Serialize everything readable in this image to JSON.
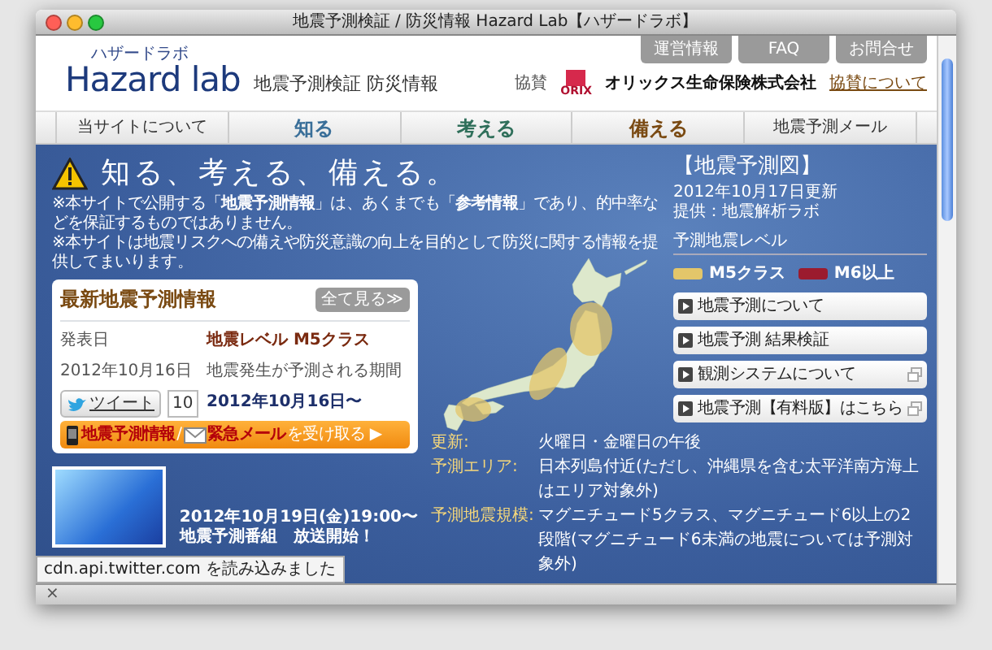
{
  "window": {
    "title": "地震予測検証 / 防災情報 Hazard Lab【ハザードラボ】"
  },
  "header": {
    "logo_kana": "ハザードラボ",
    "logo_text": "Hazard lab",
    "tagline": "地震予測検証 防災情報",
    "top_links": [
      "運営情報",
      "FAQ",
      "お問合せ"
    ],
    "sponsor": {
      "label": "協賛",
      "logo_text": "ORIX",
      "name": "オリックス生命保険株式会社",
      "link": "協賛について"
    }
  },
  "nav": [
    {
      "label": "当サイトについて",
      "color": "#333333"
    },
    {
      "label": "知る",
      "color": "#3a6f99"
    },
    {
      "label": "考える",
      "color": "#2f6f5a"
    },
    {
      "label": "備える",
      "color": "#7a4a12"
    },
    {
      "label": "地震予測メール",
      "color": "#333333"
    }
  ],
  "hero": {
    "title": "知る、考える、備える。",
    "notes": [
      "※本サイトで公開する「**地震予測情報**」は、あくまでも「**参考情報**」であり、的中率などを保証するものではありません。",
      "※本サイトは地震リスクへの備えや防災意識の向上を目的として防災に関する情報を提供してまいります。"
    ]
  },
  "latest": {
    "title": "最新地震予測情報",
    "more": "全て見る≫",
    "date_label": "発表日",
    "date": "2012年10月16日",
    "level": "地震レベル M5クラス",
    "period_label": "地震発生が予測される期間",
    "period": "2012年10月16日〜",
    "tweet": "ツイート",
    "tweet_count": "10",
    "banner": {
      "part1": "地震予測情報",
      "separator": "/",
      "part2": "緊急メール",
      "action": "を受け取る ▶"
    }
  },
  "video": {
    "caption": [
      "2012年10月19日(金)19:00〜",
      "地震予測番組　放送開始！"
    ]
  },
  "map": {
    "title": "【地震予測図】",
    "updated": "2012年10月17日更新",
    "provider": "提供：地震解析ラボ",
    "legend_title": "予測地震レベル",
    "legend": [
      {
        "label": "M5クラス",
        "color": "#e3c66a"
      },
      {
        "label": "M6以上",
        "color": "#9b1b2e"
      }
    ]
  },
  "links": [
    {
      "label": "地震予測について",
      "external": false
    },
    {
      "label": "地震予測 結果検証",
      "external": false
    },
    {
      "label": "観測システムについて",
      "external": true
    },
    {
      "label": "地震予測【有料版】はこちら",
      "external": true
    }
  ],
  "info": [
    {
      "label": "更新:",
      "value": "火曜日・金曜日の午後"
    },
    {
      "label": "予測エリア:",
      "value": "日本列島付近(ただし、沖縄県を含む太平洋南方海上はエリア対象外)"
    },
    {
      "label": "予測地震規模:",
      "value": "マグニチュード5クラス、マグニチュード6以上の2段階(マグニチュード6未満の地震については予測対象外)"
    }
  ],
  "status_bar": {
    "text": "cdn.api.twitter.com を読み込みました",
    "close": "×"
  }
}
